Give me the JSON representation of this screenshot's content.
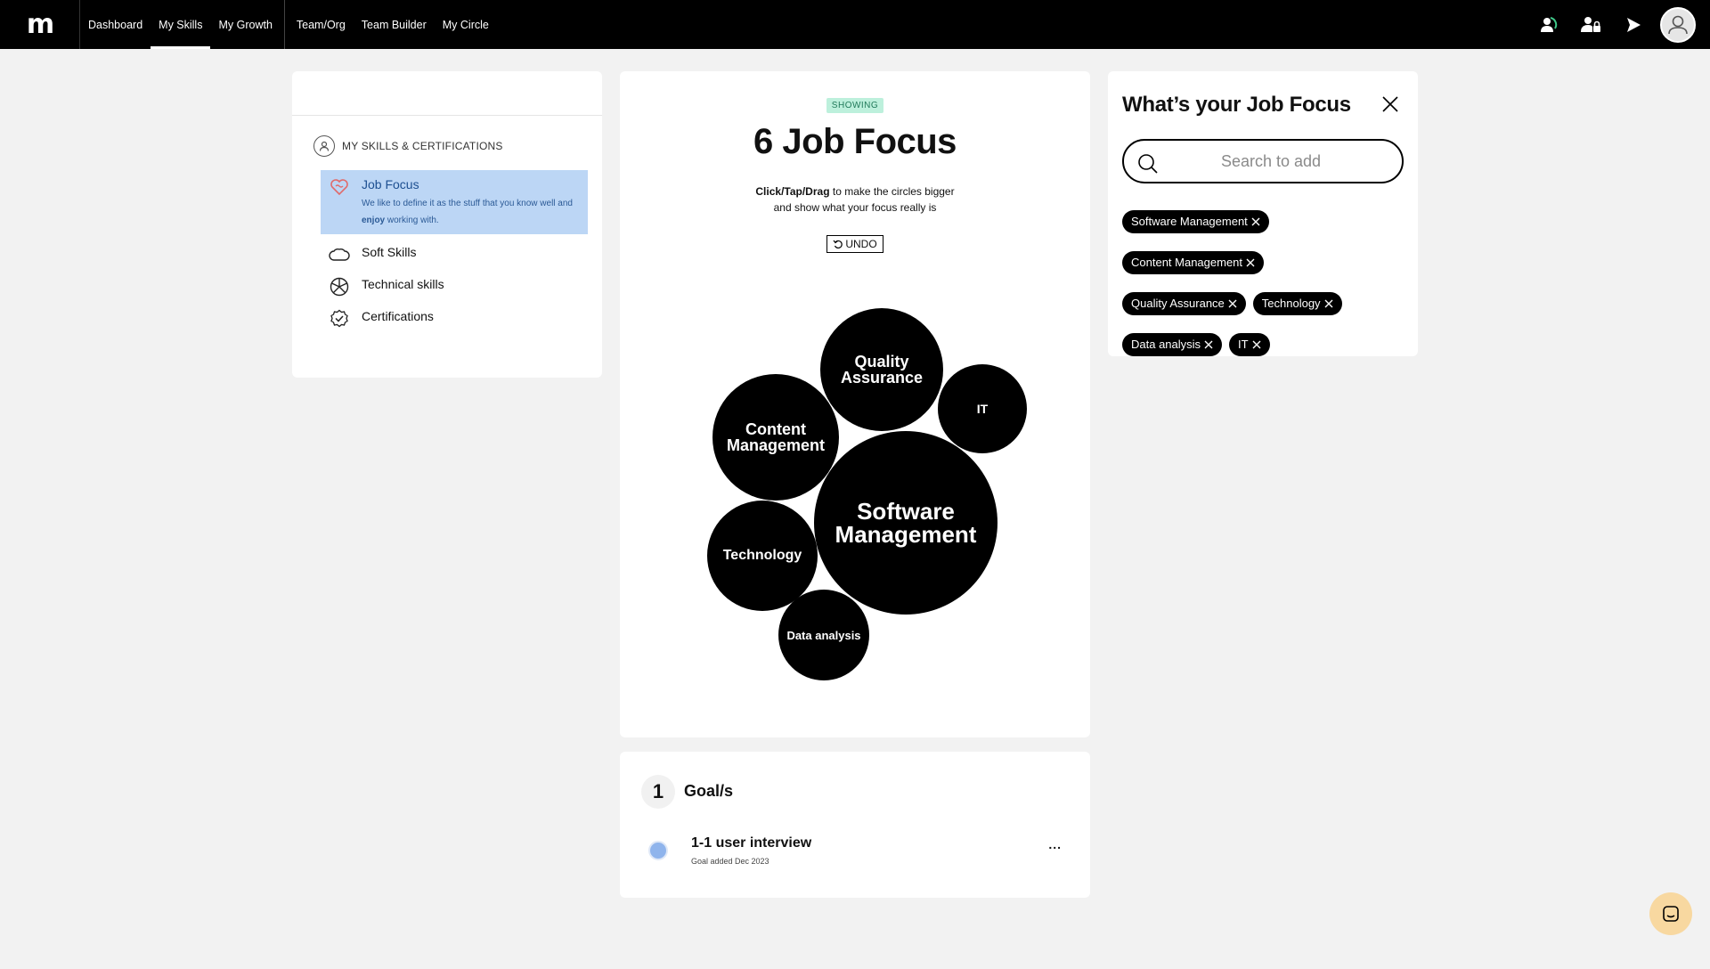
{
  "nav": {
    "logo": "m",
    "links": [
      "Dashboard",
      "My Skills",
      "My Growth",
      "Team/Org",
      "Team Builder",
      "My Circle"
    ],
    "active": "My Skills"
  },
  "sidebar": {
    "section_title": "MY SKILLS & CERTIFICATIONS",
    "items": [
      {
        "label": "Job Focus",
        "icon": "heart-brain-icon",
        "active": true,
        "desc_pre": "We like to define it as the stuff that you know well and ",
        "desc_bold": "enjoy",
        "desc_post": " working with."
      },
      {
        "label": "Soft Skills",
        "icon": "cloud-icon"
      },
      {
        "label": "Technical skills",
        "icon": "aperture-icon"
      },
      {
        "label": "Certifications",
        "icon": "badge-check-icon"
      }
    ]
  },
  "focus": {
    "badge": "SHOWING",
    "title": "6 Job Focus",
    "instr_bold": "Click/Tap/Drag",
    "instr_rest": " to make the circles bigger",
    "instr_line2": "and show what your focus really is",
    "undo": "UNDO",
    "bubbles": [
      {
        "label": "Software Management"
      },
      {
        "label": "Quality Assurance"
      },
      {
        "label": "Content Management"
      },
      {
        "label": "IT"
      },
      {
        "label": "Technology"
      },
      {
        "label": "Data analysis"
      }
    ]
  },
  "goals": {
    "count": "1",
    "heading": "Goal/s",
    "items": [
      {
        "title": "1-1 user interview",
        "date": "Goal added Dec 2023",
        "more": "..."
      }
    ]
  },
  "panel": {
    "title": "What’s your Job Focus",
    "search_placeholder": "Search to add",
    "tags": [
      "Software Management",
      "Content Management",
      "Quality Assurance",
      "Technology",
      "Data analysis",
      "IT"
    ]
  },
  "colors": {
    "nav_bg": "#000000",
    "active_menu_bg": "#bcd6f5",
    "badge_bg": "#bdf0dc",
    "goal_dot": "#8fb4ec",
    "chat_bg": "#f8d8a0",
    "page_bg": "#f2f2f2"
  }
}
